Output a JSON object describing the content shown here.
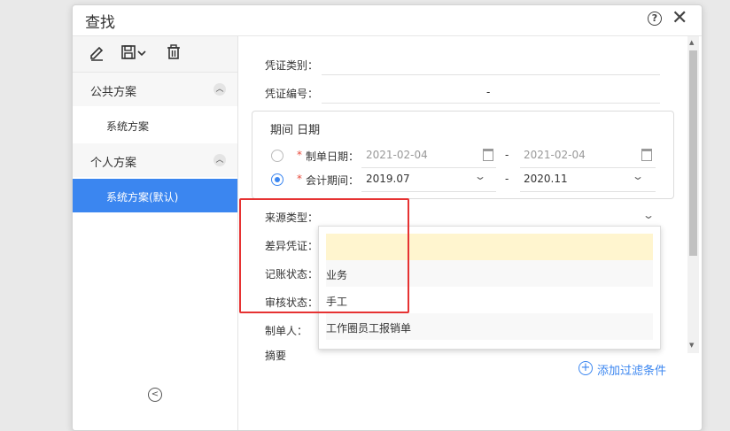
{
  "dialog": {
    "title": "查找",
    "help_icon": "question-circle-icon",
    "close_icon": "close-icon"
  },
  "toolbar": {
    "icons": [
      "edit-icon",
      "save-icon",
      "dropdown-chevron-icon",
      "delete-icon"
    ]
  },
  "sidebar": {
    "groups": [
      {
        "label": "公共方案",
        "items": [
          {
            "label": "系统方案",
            "active": false
          }
        ]
      },
      {
        "label": "个人方案",
        "items": [
          {
            "label": "系统方案(默认)",
            "active": true
          }
        ]
      }
    ],
    "collapse_icon": "chevron-up-icon",
    "back_icon": "back-circle-icon"
  },
  "fields": {
    "voucher_type": {
      "label": "凭证类别：",
      "value": ""
    },
    "voucher_no": {
      "label": "凭证编号：",
      "from": "",
      "sep": "-",
      "to": ""
    },
    "period": {
      "title": "期间 日期",
      "date_row": {
        "required": "*",
        "label": "制单日期：",
        "from": "2021-02-04",
        "sep": "-",
        "to": "2021-02-04",
        "selected": false
      },
      "period_row": {
        "required": "*",
        "label": "会计期间：",
        "from": "2019.07",
        "sep": "-",
        "to": "2020.11",
        "selected": true
      }
    },
    "source_type": {
      "label": "来源类型：",
      "value": ""
    },
    "diff_voucher": {
      "label": "差异凭证："
    },
    "posting_status": {
      "label": "记账状态："
    },
    "audit_status": {
      "label": "审核状态："
    },
    "creator": {
      "label": "制单人："
    },
    "summary": {
      "label": "摘要"
    }
  },
  "source_dropdown": {
    "options": [
      "",
      "业务",
      "手工",
      "工作圈员工报销单"
    ],
    "highlighted_index": 0
  },
  "add_filter": {
    "label": "添加过滤条件",
    "icon": "plus-circle-icon"
  },
  "colors": {
    "accent": "#3b86f0",
    "highlight": "#fff5cf",
    "annotation": "#e63232",
    "required": "#e84c3d"
  }
}
